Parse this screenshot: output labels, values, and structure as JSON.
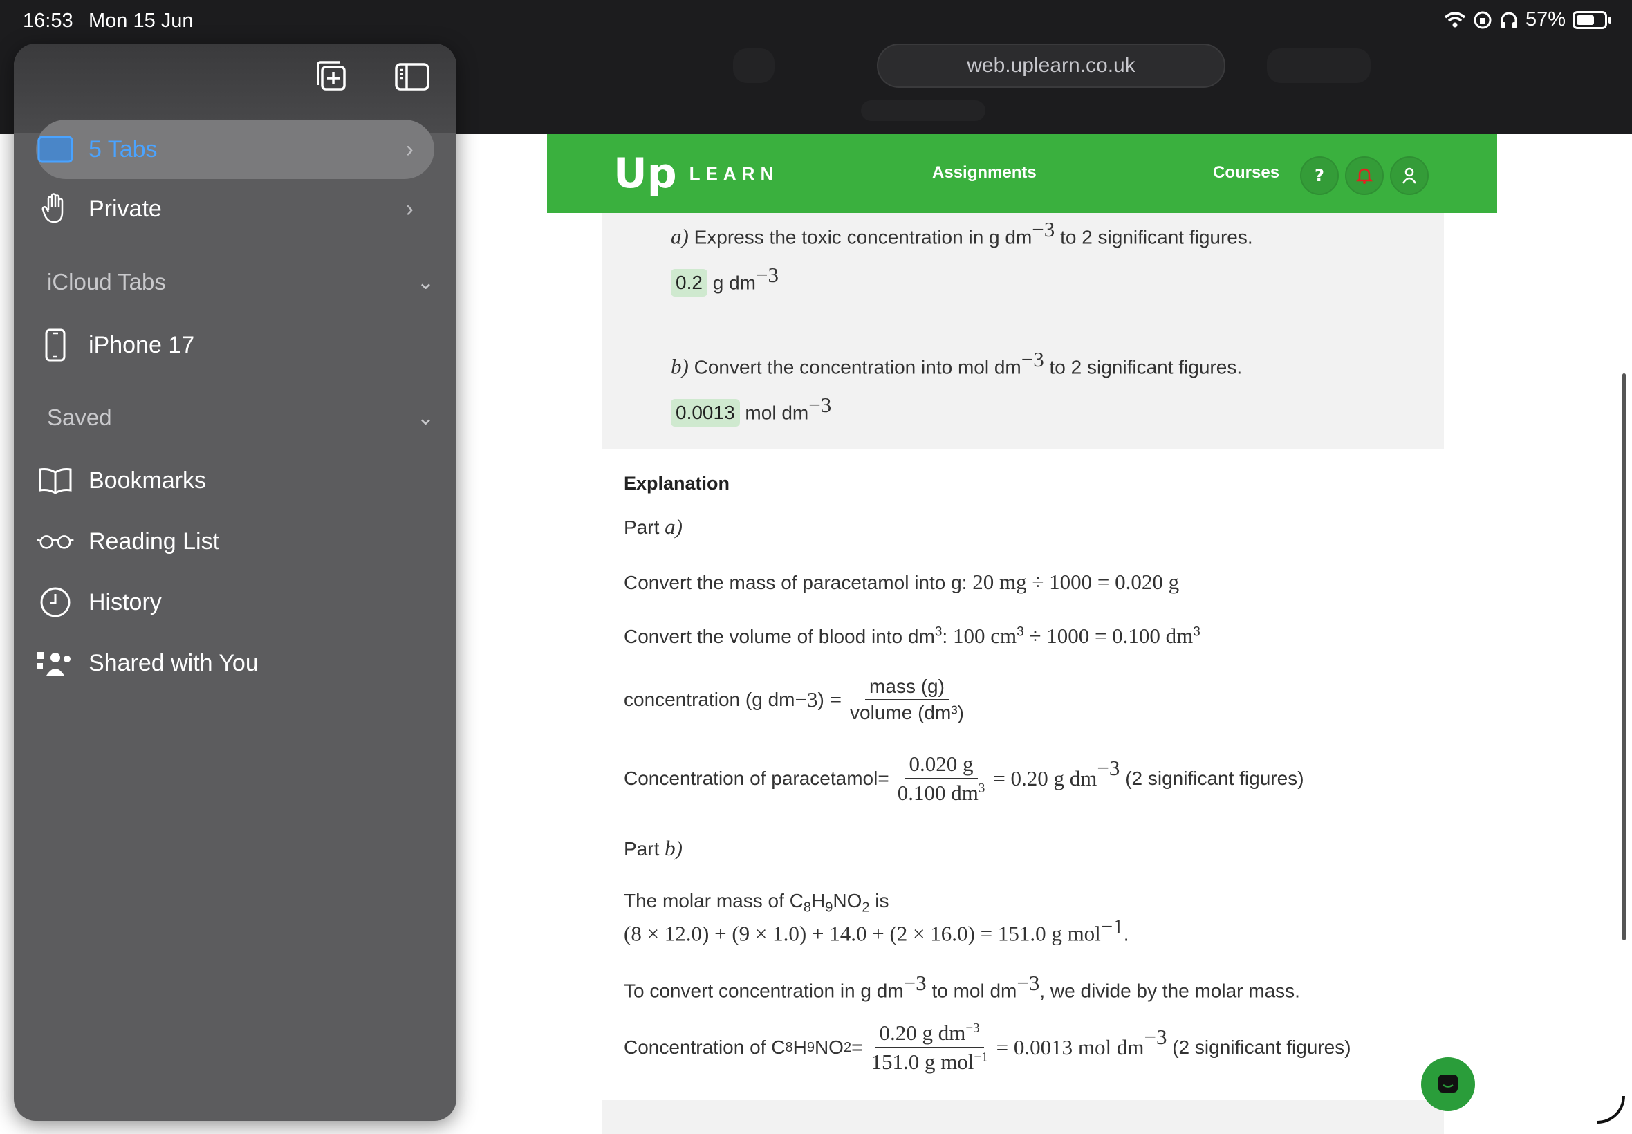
{
  "status": {
    "time": "16:53",
    "date": "Mon 15 Jun",
    "battery": "57%"
  },
  "browser": {
    "url": "web.uplearn.co.uk"
  },
  "sidebar": {
    "tabs_label": "5 Tabs",
    "private_label": "Private",
    "icloud_section": "iCloud Tabs",
    "device_label": "iPhone 17",
    "saved_section": "Saved",
    "bookmarks_label": "Bookmarks",
    "reading_list_label": "Reading List",
    "history_label": "History",
    "shared_label": "Shared with You"
  },
  "nav": {
    "logo_up": "Up",
    "logo_learn": "LEARN",
    "assignments": "Assignments",
    "courses": "Courses",
    "help": "?"
  },
  "question": {
    "a_label": "a)",
    "a_text": "Express the toxic concentration in g dm",
    "a_exp": "−3",
    "a_tail": "to 2 significant figures.",
    "a_answer": "0.2",
    "a_unit": "g dm",
    "a_unit_exp": "−3",
    "b_label": "b)",
    "b_text": "Convert the concentration into mol dm",
    "b_exp": "−3",
    "b_tail": "to 2 significant figures.",
    "b_answer": "0.0013",
    "b_unit": "mol dm",
    "b_unit_exp": "−3"
  },
  "explanation": {
    "heading": "Explanation",
    "part_a": "Part",
    "part_a_var": "a)",
    "line1_text": "Convert the mass of paracetamol into g:",
    "line1_math": "20 mg ÷ 1000 = 0.020 g",
    "line2_text": "Convert the volume of blood into dm",
    "line2_colon": ":",
    "line2_math": "100 cm",
    "line2_math2": "÷ 1000 = 0.100 dm",
    "conc_label": "concentration",
    "conc_unit": "(g dm",
    "conc_unit_close": ")",
    "conc_eq": "=",
    "conc_num": "mass (g)",
    "conc_den": "volume (dm³)",
    "para_label": "Concentration of paracetamol=",
    "para_num": "0.020 g",
    "para_den": "0.100 dm",
    "para_result": "= 0.20 g dm",
    "para_note": "(2 significant figures)",
    "part_b": "Part",
    "part_b_var": "b)",
    "molar_text": "The molar mass of C",
    "molar_is": "is",
    "molar_calc": "(8 × 12.0) + (9 × 1.0) + 14.0 + (2 × 16.0) = 151.0 g mol",
    "molar_exp": "−1",
    "convert_text": "To convert concentration in g dm",
    "convert_mid": "to mol dm",
    "convert_tail": ", we divide by the molar mass.",
    "final_label": "Concentration of C",
    "final_num": "0.20 g dm",
    "final_den": "151.0 g mol",
    "final_result": "= 0.0013 mol dm",
    "final_note": "(2 significant figures)"
  },
  "colors": {
    "brand_green": "#3ab03e",
    "answer_bg": "#cfe9cf",
    "sidebar_bg": "#5c5c5e",
    "active_tab_text": "#4aa3ff"
  }
}
